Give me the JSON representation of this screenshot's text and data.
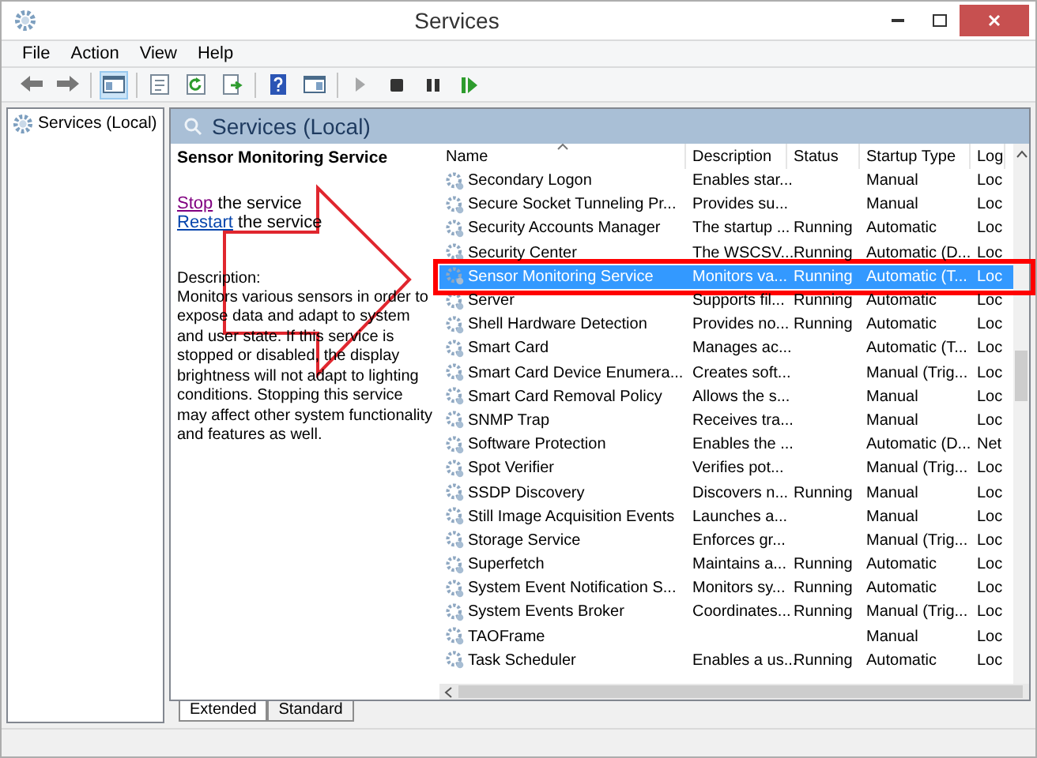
{
  "window": {
    "title": "Services"
  },
  "menu": [
    "File",
    "Action",
    "View",
    "Help"
  ],
  "toolbar": [
    {
      "kind": "back",
      "disabled": false
    },
    {
      "kind": "forward",
      "disabled": false
    },
    {
      "kind": "sep"
    },
    {
      "kind": "console-tree",
      "selected": true
    },
    {
      "kind": "sep"
    },
    {
      "kind": "properties",
      "selected": false
    },
    {
      "kind": "refresh",
      "selected": false
    },
    {
      "kind": "export",
      "selected": false
    },
    {
      "kind": "sep"
    },
    {
      "kind": "help",
      "selected": false
    },
    {
      "kind": "action-pane",
      "selected": false
    },
    {
      "kind": "sep"
    },
    {
      "kind": "play",
      "disabled": true
    },
    {
      "kind": "stop",
      "disabled": false
    },
    {
      "kind": "pause",
      "disabled": false
    },
    {
      "kind": "resume",
      "disabled": false
    }
  ],
  "tree": {
    "items": [
      {
        "label": "Services (Local)",
        "selected": false
      }
    ]
  },
  "pane": {
    "title": "Services (Local)"
  },
  "details": {
    "title": "Sensor Monitoring Service",
    "actions": [
      {
        "link": "Stop",
        "text": " the service",
        "visited": true
      },
      {
        "link": "Restart",
        "text": " the service",
        "visited": false
      }
    ],
    "description_label": "Description:",
    "description": "Monitors various sensors in order to expose data and adapt to system and user state.  If this service is stopped or disabled, the display brightness will not adapt to lighting conditions. Stopping this service may affect other system functionality and features as well."
  },
  "table": {
    "columns": [
      {
        "label": "Name",
        "sorted": true
      },
      {
        "label": "Description",
        "sorted": false
      },
      {
        "label": "Status",
        "sorted": false
      },
      {
        "label": "Startup Type",
        "sorted": false
      },
      {
        "label": "Log",
        "sorted": false
      }
    ],
    "rows": [
      {
        "cells": [
          "Secondary Logon",
          "Enables star...",
          "",
          "Manual",
          "Loc"
        ],
        "selected": false
      },
      {
        "cells": [
          "Secure Socket Tunneling Pr...",
          "Provides su...",
          "",
          "Manual",
          "Loc"
        ],
        "selected": false
      },
      {
        "cells": [
          "Security Accounts Manager",
          "The startup ...",
          "Running",
          "Automatic",
          "Loc"
        ],
        "selected": false
      },
      {
        "cells": [
          "Security Center",
          "The WSCSV...",
          "Running",
          "Automatic (D...",
          "Loc"
        ],
        "selected": false
      },
      {
        "cells": [
          "Sensor Monitoring Service",
          "Monitors va...",
          "Running",
          "Automatic (T...",
          "Loc"
        ],
        "selected": true
      },
      {
        "cells": [
          "Server",
          "Supports fil...",
          "Running",
          "Automatic",
          "Loc"
        ],
        "selected": false
      },
      {
        "cells": [
          "Shell Hardware Detection",
          "Provides no...",
          "Running",
          "Automatic",
          "Loc"
        ],
        "selected": false
      },
      {
        "cells": [
          "Smart Card",
          "Manages ac...",
          "",
          "Automatic (T...",
          "Loc"
        ],
        "selected": false
      },
      {
        "cells": [
          "Smart Card Device Enumera...",
          "Creates soft...",
          "",
          "Manual (Trig...",
          "Loc"
        ],
        "selected": false
      },
      {
        "cells": [
          "Smart Card Removal Policy",
          "Allows the s...",
          "",
          "Manual",
          "Loc"
        ],
        "selected": false
      },
      {
        "cells": [
          "SNMP Trap",
          "Receives tra...",
          "",
          "Manual",
          "Loc"
        ],
        "selected": false
      },
      {
        "cells": [
          "Software Protection",
          "Enables the ...",
          "",
          "Automatic (D...",
          "Net"
        ],
        "selected": false
      },
      {
        "cells": [
          "Spot Verifier",
          "Verifies pot...",
          "",
          "Manual (Trig...",
          "Loc"
        ],
        "selected": false
      },
      {
        "cells": [
          "SSDP Discovery",
          "Discovers n...",
          "Running",
          "Manual",
          "Loc"
        ],
        "selected": false
      },
      {
        "cells": [
          "Still Image Acquisition Events",
          "Launches a...",
          "",
          "Manual",
          "Loc"
        ],
        "selected": false
      },
      {
        "cells": [
          "Storage Service",
          "Enforces gr...",
          "",
          "Manual (Trig...",
          "Loc"
        ],
        "selected": false
      },
      {
        "cells": [
          "Superfetch",
          "Maintains a...",
          "Running",
          "Automatic",
          "Loc"
        ],
        "selected": false
      },
      {
        "cells": [
          "System Event Notification S...",
          "Monitors sy...",
          "Running",
          "Automatic",
          "Loc"
        ],
        "selected": false
      },
      {
        "cells": [
          "System Events Broker",
          "Coordinates...",
          "Running",
          "Manual (Trig...",
          "Loc"
        ],
        "selected": false
      },
      {
        "cells": [
          "TAOFrame",
          "",
          "",
          "Manual",
          "Loc"
        ],
        "selected": false
      },
      {
        "cells": [
          "Task Scheduler",
          "Enables a us...",
          "Running",
          "Automatic",
          "Loc"
        ],
        "selected": false
      }
    ]
  },
  "tabs": [
    {
      "label": "Extended",
      "selected": true
    },
    {
      "label": "Standard",
      "selected": false
    }
  ],
  "annotations": {
    "arrow": true,
    "row_box": true
  }
}
